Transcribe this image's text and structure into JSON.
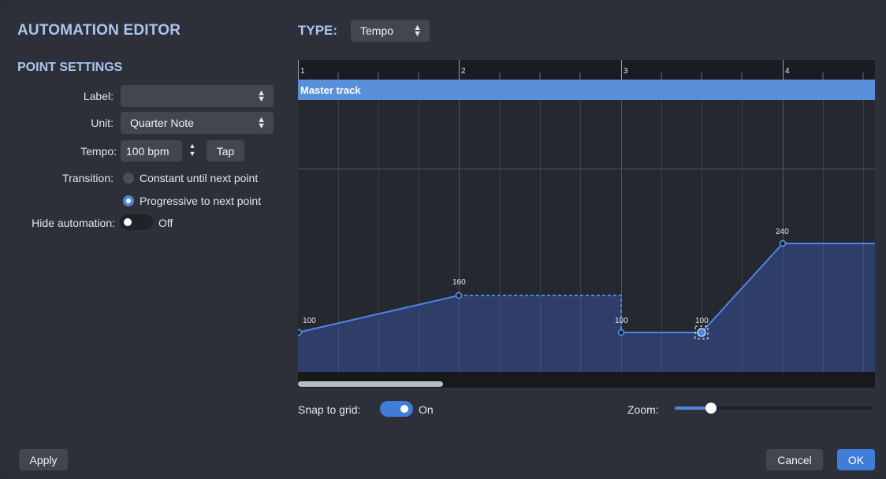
{
  "header": {
    "title": "AUTOMATION EDITOR",
    "type_label": "TYPE:",
    "type_value": "Tempo"
  },
  "point_settings": {
    "heading": "POINT SETTINGS",
    "label_label": "Label:",
    "label_value": "",
    "unit_label": "Unit:",
    "unit_value": "Quarter Note",
    "tempo_label": "Tempo:",
    "tempo_value": "100 bpm",
    "tap_label": "Tap",
    "transition_label": "Transition:",
    "transition_options": [
      {
        "label": "Constant until next point",
        "selected": false
      },
      {
        "label": "Progressive to next point",
        "selected": true
      }
    ],
    "hide_label": "Hide automation:",
    "hide_state": "Off"
  },
  "editor": {
    "ruler_bars": [
      "1",
      "2",
      "3",
      "4"
    ],
    "track_name": "Master track",
    "point_values": [
      "100",
      "160",
      "100",
      "100",
      "240"
    ]
  },
  "footer": {
    "snap_label": "Snap to grid:",
    "snap_state": "On",
    "zoom_label": "Zoom:",
    "zoom_level": 0.19,
    "apply_label": "Apply",
    "cancel_label": "Cancel",
    "ok_label": "OK"
  },
  "colors": {
    "accent": "#3f7ddb",
    "heading": "#a9c6ee",
    "curve": "#4a86e8",
    "track_bar": "#5a8fd9",
    "fill": "#2e3f6b"
  }
}
